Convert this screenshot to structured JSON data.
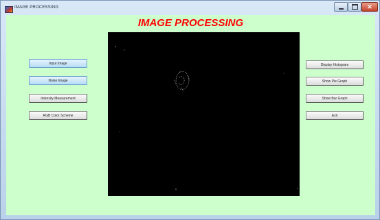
{
  "window": {
    "title": "IMAGE PROCESSING",
    "controls": {
      "minimize": "minimize-icon",
      "maximize": "maximize-icon",
      "close": "close-icon"
    }
  },
  "app": {
    "heading": "IMAGE PROCESSING"
  },
  "left_buttons": [
    {
      "label": "Input Image",
      "style": "selected"
    },
    {
      "label": "Noise Image",
      "style": "selected"
    },
    {
      "label": "Intensity Measurement",
      "style": "normal"
    },
    {
      "label": "RGB Color Scheme",
      "style": "normal"
    }
  ],
  "right_buttons": [
    {
      "label": "Display Histogram"
    },
    {
      "label": "Show Pie Graph"
    },
    {
      "label": "Show Bar Graph"
    },
    {
      "label": "Exit"
    }
  ],
  "colors": {
    "background": "#ccffcc",
    "heading": "#ff0000",
    "axes": "#000000",
    "selected_button": "#b7dcf5"
  }
}
